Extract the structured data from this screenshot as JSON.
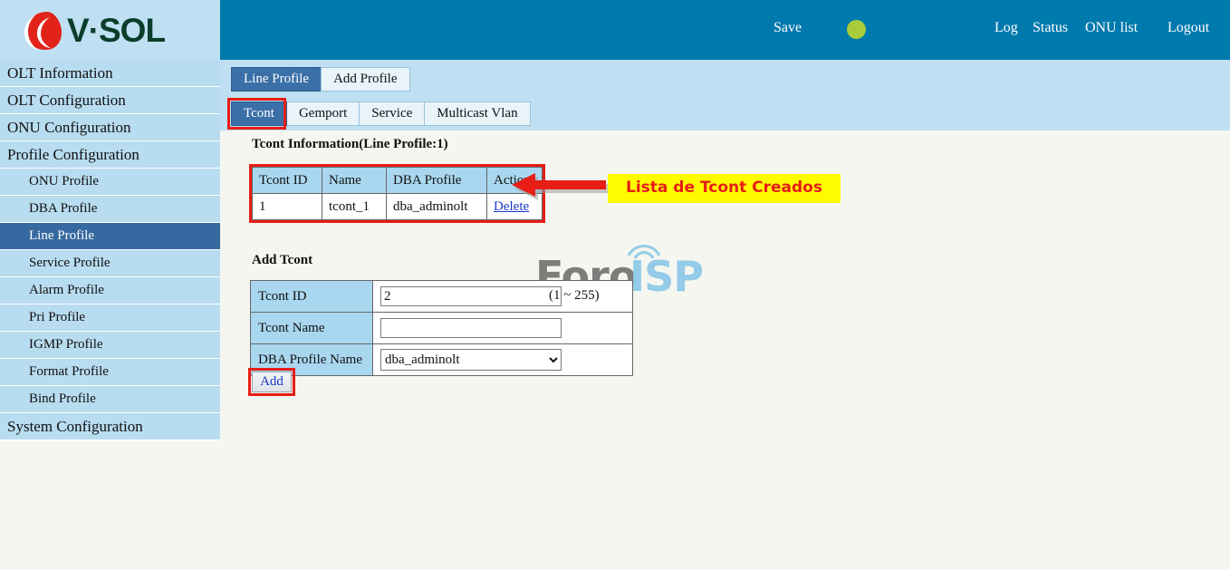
{
  "brand": {
    "name": "V·SOL",
    "logo_icon": "vsol-swirl-icon",
    "logo_color": "#e2231a",
    "text_color": "#0b3d2c"
  },
  "header": {
    "background": "#0079ad",
    "save_label": "Save",
    "status_indicator": {
      "icon": "status-dot-icon",
      "color": "#a8cc3a"
    },
    "nav": [
      {
        "label": "Log"
      },
      {
        "label": "Status"
      },
      {
        "label": "ONU list"
      },
      {
        "label": "Logout"
      }
    ]
  },
  "sidebar": {
    "items": [
      {
        "label": "OLT Information",
        "level": "top",
        "active": false
      },
      {
        "label": "OLT Configuration",
        "level": "top",
        "active": false
      },
      {
        "label": "ONU Configuration",
        "level": "top",
        "active": false
      },
      {
        "label": "Profile Configuration",
        "level": "top",
        "active": false
      },
      {
        "label": "ONU Profile",
        "level": "sub",
        "active": false
      },
      {
        "label": "DBA Profile",
        "level": "sub",
        "active": false
      },
      {
        "label": "Line Profile",
        "level": "sub",
        "active": true
      },
      {
        "label": "Service Profile",
        "level": "sub",
        "active": false
      },
      {
        "label": "Alarm Profile",
        "level": "sub",
        "active": false
      },
      {
        "label": "Pri Profile",
        "level": "sub",
        "active": false
      },
      {
        "label": "IGMP Profile",
        "level": "sub",
        "active": false
      },
      {
        "label": "Format Profile",
        "level": "sub",
        "active": false
      },
      {
        "label": "Bind Profile",
        "level": "sub",
        "active": false
      },
      {
        "label": "System Configuration",
        "level": "top",
        "active": false
      }
    ]
  },
  "tabs": {
    "primary": [
      {
        "label": "Line Profile",
        "active": true
      },
      {
        "label": "Add Profile",
        "active": false
      }
    ],
    "secondary": [
      {
        "label": "Tcont",
        "active": true,
        "annotated": true
      },
      {
        "label": "Gemport",
        "active": false,
        "annotated": false
      },
      {
        "label": "Service",
        "active": false,
        "annotated": false
      },
      {
        "label": "Multicast Vlan",
        "active": false,
        "annotated": false
      }
    ]
  },
  "main": {
    "info_section_title": "Tcont Information(Line Profile:1)",
    "info_table": {
      "headers": [
        "Tcont ID",
        "Name",
        "DBA Profile",
        "Action"
      ],
      "rows": [
        {
          "tcont_id": "1",
          "name": "tcont_1",
          "dba_profile": "dba_adminolt",
          "action": "Delete"
        }
      ]
    },
    "annotation": {
      "text": "Lista de Tcont Creados",
      "background": "#fffc00",
      "text_color": "#e71d16",
      "arrow_icon": "left-arrow-icon",
      "arrow_color": "#e71d16"
    },
    "add_section_title": "Add Tcont",
    "add_form": {
      "tcont_id": {
        "label": "Tcont ID",
        "value": "2",
        "placeholder": "",
        "hint": "(1 ~ 255)"
      },
      "tcont_name": {
        "label": "Tcont Name",
        "value": "",
        "placeholder": ""
      },
      "dba_profile_name": {
        "label": "DBA Profile Name",
        "selected": "dba_adminolt",
        "options": [
          "dba_adminolt"
        ],
        "chevron_icon": "chevron-down-icon"
      },
      "submit_label": "Add"
    }
  },
  "watermark": {
    "text_primary": "Foro",
    "text_secondary": "ISP",
    "primary_color": "#7d7d7b",
    "secondary_color": "#94cbe8",
    "icon": "wifi-signal-icon"
  }
}
